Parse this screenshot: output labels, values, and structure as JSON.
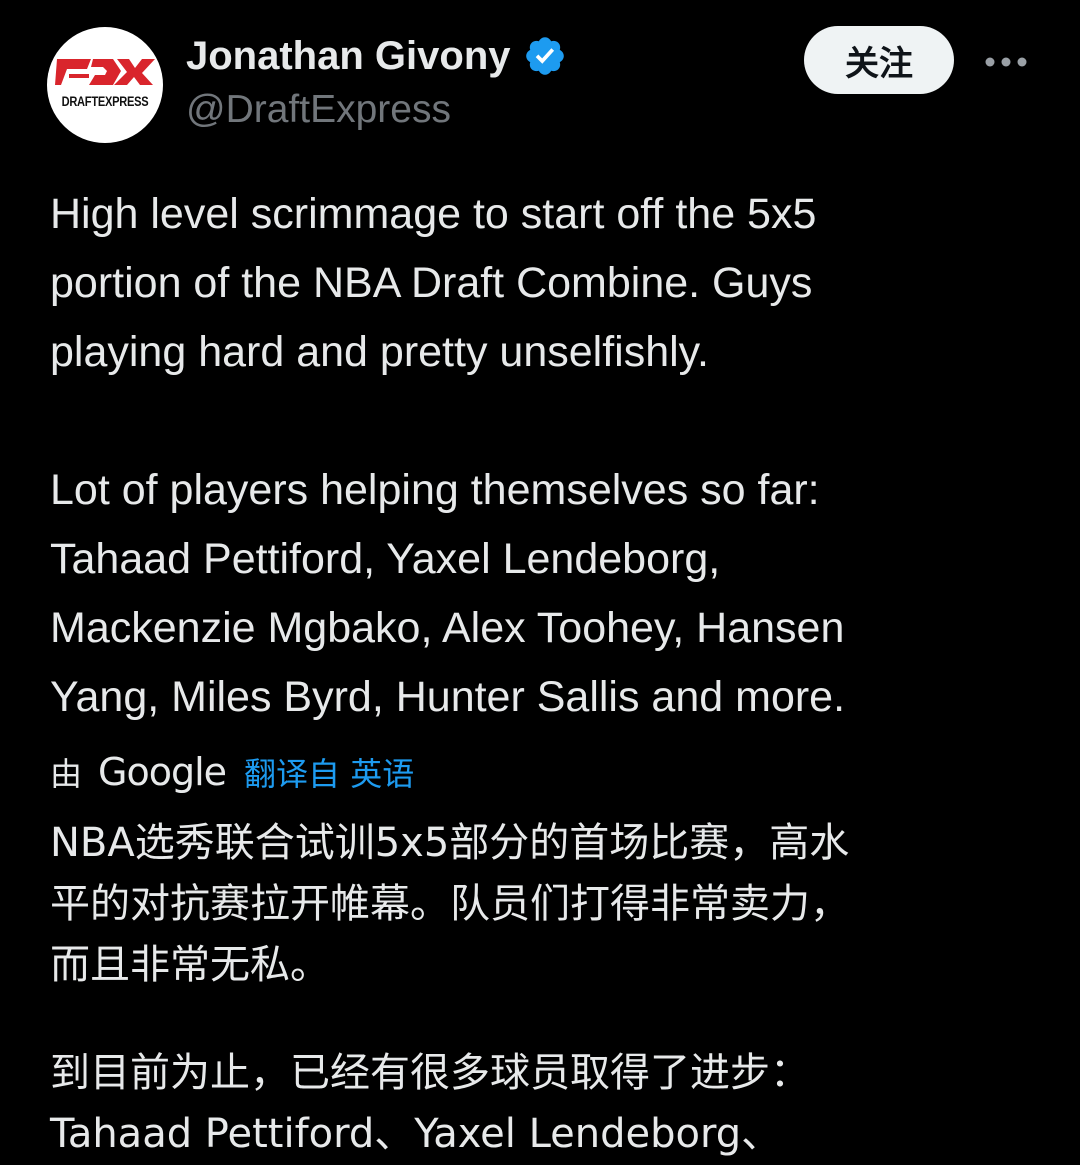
{
  "author": {
    "display_name": "Jonathan Givony",
    "handle": "@DraftExpress",
    "avatar_logo_text": "DRAFTEXPRESS",
    "verified": true
  },
  "actions": {
    "follow_label": "关注",
    "more_icon": "more-horizontal-icon"
  },
  "tweet": {
    "original_paragraph_1": "High level scrimmage to start off the 5x5\nportion of the NBA Draft Combine. Guys\nplaying hard and pretty unselfishly.",
    "original_paragraph_2": "Lot of players helping themselves so far:\nTahaad Pettiford, Yaxel Lendeborg,\nMackenzie Mgbako, Alex Toohey, Hansen\nYang, Miles Byrd, Hunter Sallis and more.",
    "translation_prefix": "由",
    "translation_provider": "Google",
    "translation_source": "翻译自 英语",
    "translated_paragraph_1": "NBA选秀联合试训5x5部分的首场比赛，高水\n平的对抗赛拉开帷幕。队员们打得非常卖力，\n而且非常无私。",
    "translated_paragraph_2": "到目前为止，已经有很多球员取得了进步：\nTahaad Pettiford、Yaxel Lendeborg、"
  },
  "colors": {
    "background": "#000000",
    "text_primary": "#e7e9ea",
    "text_secondary": "#71767b",
    "link_blue": "#1d9bf0",
    "logo_red": "#d9252c",
    "follow_button_bg": "#eff3f4"
  }
}
